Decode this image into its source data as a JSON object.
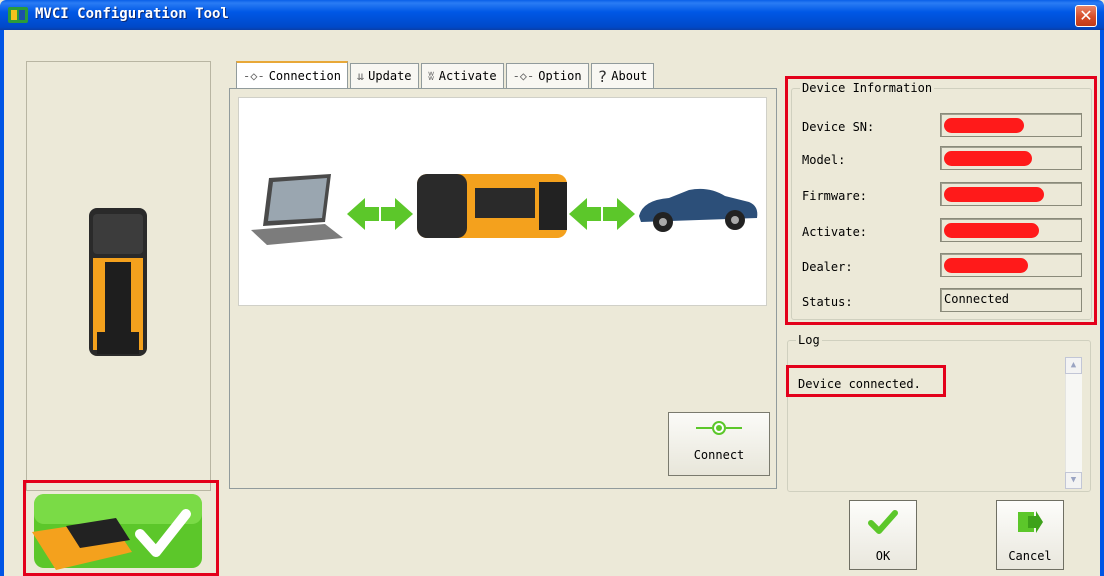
{
  "window": {
    "title": "MVCI Configuration Tool",
    "close_glyph": "✕"
  },
  "tabs": [
    {
      "label": "Connection",
      "icon": "connection-icon",
      "icon_glyph": "-◇-",
      "active": true
    },
    {
      "label": "Update",
      "icon": "update-icon",
      "icon_glyph": "⇊"
    },
    {
      "label": "Activate",
      "icon": "activate-icon",
      "icon_glyph": "ʬ"
    },
    {
      "label": "Option",
      "icon": "option-icon",
      "icon_glyph": "-◇-"
    },
    {
      "label": "About",
      "icon": "help-icon",
      "icon_glyph": "?"
    }
  ],
  "connect_button": {
    "label": "Connect"
  },
  "device_info": {
    "title": "Device Information",
    "rows": [
      {
        "label": "Device SN:",
        "value": "",
        "redacted": true
      },
      {
        "label": "Model:",
        "value": "",
        "redacted": true
      },
      {
        "label": "Firmware:",
        "value": "",
        "redacted": true
      },
      {
        "label": "Activate:",
        "value": "",
        "redacted": true
      },
      {
        "label": "Dealer:",
        "value": "",
        "redacted": true
      },
      {
        "label": "Status:",
        "value": "Connected",
        "redacted": false
      }
    ]
  },
  "log": {
    "title": "Log",
    "lines": [
      "Device connected."
    ]
  },
  "buttons": {
    "ok": "OK",
    "cancel": "Cancel"
  },
  "colors": {
    "titlebar": "#0058e6",
    "highlight_box": "#e3001b",
    "redaction": "#ff1a1a",
    "arrow_green": "#5cc72a",
    "device_orange": "#f4a11d"
  }
}
